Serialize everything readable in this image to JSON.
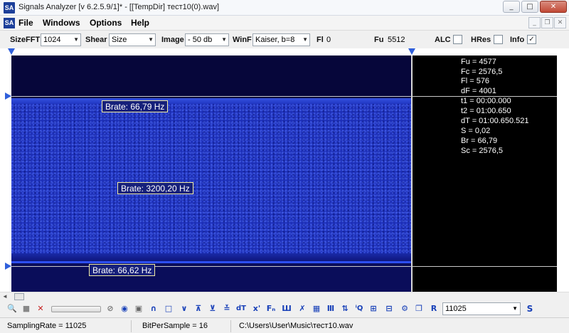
{
  "titlebar": {
    "app_icon_text": "SA",
    "title": "Signals Analyzer [v 6.2.5.9/1]* - [[TempDir] тест10(0).wav]",
    "buttons": {
      "minimize": "_",
      "maximize": "□",
      "close": "✕"
    }
  },
  "menubar": {
    "mdi_icon_text": "SA",
    "items": [
      "File",
      "Windows",
      "Options",
      "Help"
    ],
    "mdi_buttons": {
      "minimize": "_",
      "restore": "❐",
      "close": "✕"
    }
  },
  "toolbar": {
    "sizefft_label": "SizeFFT",
    "sizefft_value": "1024",
    "shear_label": "Shear",
    "shear_value": "Size",
    "image_label": "Image",
    "image_value": "- 50 db",
    "winf_label": "WinF",
    "winf_value": "Kaiser, b=8",
    "fl_label": "Fl",
    "fl_value": "0",
    "fu_label": "Fu",
    "fu_value": "5512",
    "alc_label": "ALC",
    "alc_checked": false,
    "hres_label": "HRes",
    "hres_checked": false,
    "info_label": "Info",
    "info_checked": true,
    "check_glyph": "✓"
  },
  "info_panel": {
    "lines": [
      "Fu = 4577",
      "Fc = 2576,5",
      "Fl = 576",
      "dF = 4001",
      "t1 = 00:00.000",
      "t2 = 01:00.650",
      "dT = 01:00.650.521",
      "S = 0,02",
      "Br = 66,79",
      "Sc = 2576,5"
    ]
  },
  "rate_labels": {
    "top": "Brate: 66,79 Hz",
    "middle": "Brate: 3200,20 Hz",
    "bottom": "Brate: 66,62 Hz"
  },
  "bottombar": {
    "icons": [
      "magnify-icon",
      "stop-icon",
      "delete-icon",
      "zoom-icon",
      "play-icon",
      "square-icon",
      "arc-up-icon",
      "square-outline-icon",
      "arc-down-icon",
      "mark-up-icon",
      "mark-down-icon",
      "mark-both-icon",
      "dt-icon",
      "x-power-icon",
      "f-sub-icon",
      "comb-icon",
      "cross-icon",
      "grid-icon",
      "bars-icon",
      "split-icon",
      "low-q-icon",
      "pulse-icon",
      "pattern-icon",
      "gear-icon",
      "copy-icon",
      "r-icon"
    ],
    "sample_rate_value": "11025",
    "s_button": "S"
  },
  "statusbar": {
    "sampling_rate": "SamplingRate = 11025",
    "bit_per_sample": "BitPerSample = 16",
    "file_path": "C:\\Users\\User\\Music\\тест10.wav"
  },
  "colors": {
    "spectrum_blue": "#1d2fb8",
    "background_dark": "#06073c",
    "marker_blue": "#2f5fdb",
    "label_border": "#f0eaa0"
  }
}
